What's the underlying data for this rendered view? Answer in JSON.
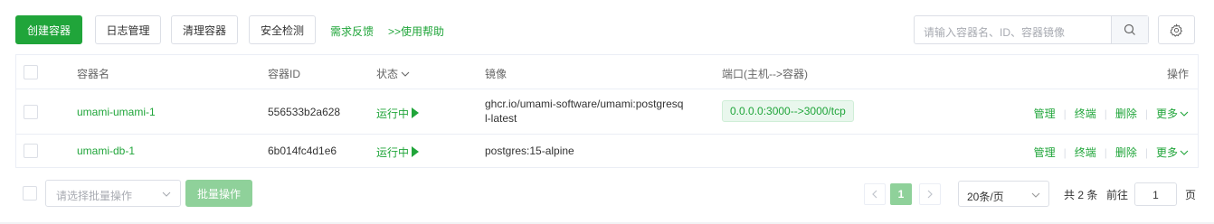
{
  "toolbar": {
    "create_label": "创建容器",
    "logs_label": "日志管理",
    "clean_label": "清理容器",
    "security_label": "安全检测",
    "feedback_link": "需求反馈",
    "help_link": ">>使用帮助",
    "search_placeholder": "请输入容器名、ID、容器镜像"
  },
  "table": {
    "headers": [
      "容器名",
      "容器ID",
      "状态",
      "镜像",
      "端口(主机-->容器)",
      "操作"
    ],
    "rows": [
      {
        "name": "umami-umami-1",
        "id": "556533b2a628",
        "status": "运行中",
        "image_line1": "ghcr.io/umami-software/umami:postgresq",
        "image_line2": "l-latest",
        "port": "0.0.0.0:3000-->3000/tcp"
      },
      {
        "name": "umami-db-1",
        "id": "6b014fc4d1e6",
        "status": "运行中",
        "image_line1": "postgres:15-alpine",
        "image_line2": "",
        "port": ""
      }
    ],
    "actions": {
      "manage": "管理",
      "terminal": "终端",
      "delete": "删除",
      "more": "更多"
    }
  },
  "footer": {
    "batch_select_placeholder": "请选择批量操作",
    "batch_button": "批量操作",
    "current_page": "1",
    "page_size": "20条/页",
    "total": "共 2 条",
    "goto_label": "前往",
    "goto_value": "1",
    "page_unit": "页"
  },
  "colors": {
    "accent": "#20a53a",
    "accent_light": "#8fd19a",
    "border": "#dcdfe6"
  }
}
